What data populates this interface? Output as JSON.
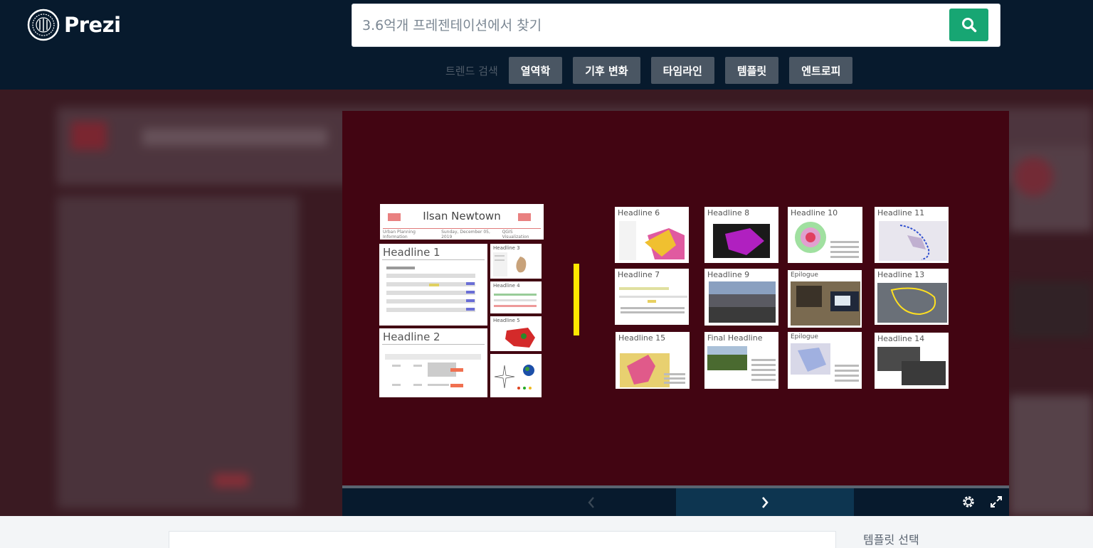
{
  "header": {
    "logo_text": "Prezi",
    "search": {
      "placeholder": "3.6억개 프레젠테이션에서 찾기"
    },
    "trend_label": "트렌드 검색",
    "trends": [
      "열역학",
      "기후 변화",
      "타임라인",
      "템플릿",
      "엔트로피"
    ]
  },
  "presentation": {
    "title_slide": {
      "title": "Ilsan Newtown",
      "subtitle_left": "Urban Planning Information",
      "subtitle_mid": "Sunday, December 05, 2019",
      "subtitle_right": "QGIS Visualization"
    },
    "slides": {
      "h1": "Headline 1",
      "h2": "Headline 2",
      "h3": "Headline 3",
      "h4": "Headline 4",
      "h5": "Headline 5",
      "h6": "Headline 6",
      "h7": "Headline 7",
      "h8": "Headline 8",
      "h9": "Headline 9",
      "h10": "Headline 10",
      "h11": "Headline 11",
      "h13": "Headline 13",
      "h14": "Headline 14",
      "h15": "Headline 15",
      "final": "Final Headline",
      "epilogue_a": "Epilogue",
      "epilogue_b": "Epilogue"
    }
  },
  "controls": {
    "prev_icon": "chevron-left-icon",
    "next_icon": "chevron-right-icon",
    "settings_icon": "gear-icon",
    "fullscreen_icon": "fullscreen-icon"
  },
  "bottom": {
    "template_select": "템플릿 선택"
  },
  "colors": {
    "header_bg": "#071a2d",
    "viewer_bg": "#420512",
    "search_button": "#17a673",
    "trend_chip": "#4a5663",
    "accent_yellow": "#ffe600"
  }
}
